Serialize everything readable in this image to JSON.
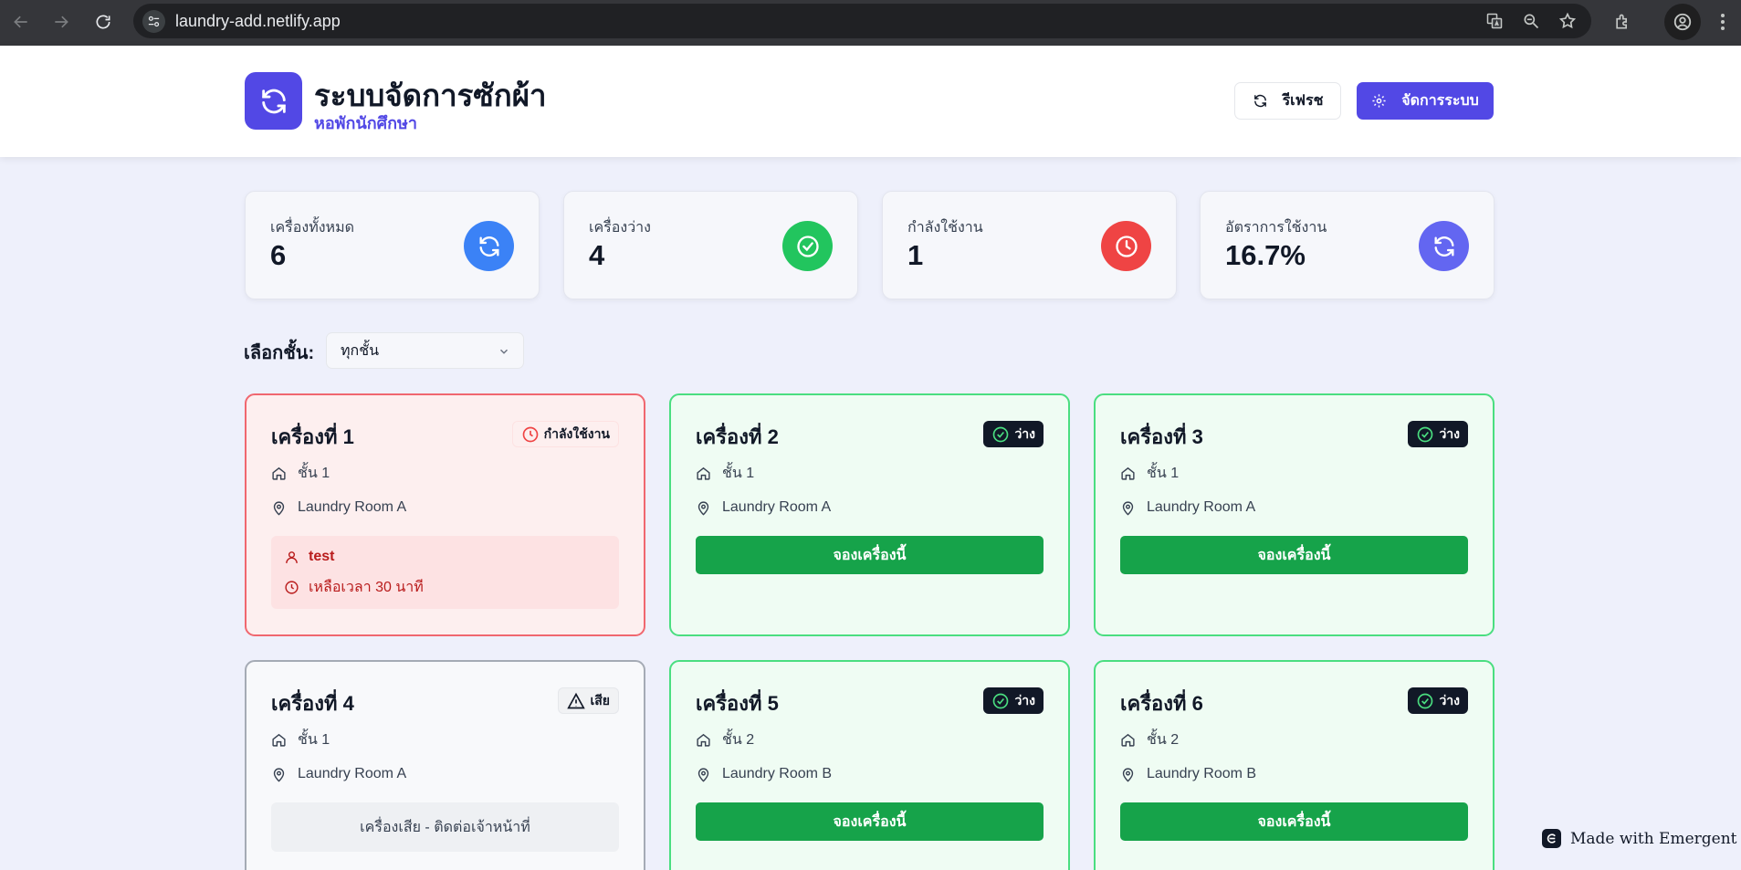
{
  "browser": {
    "url": "laundry-add.netlify.app"
  },
  "header": {
    "title": "ระบบจัดการซักผ้า",
    "subtitle": "หอพักนักศึกษา",
    "refresh_label": "รีเฟรช",
    "manage_label": "จัดการระบบ"
  },
  "stats": [
    {
      "label": "เครื่องทั้งหมด",
      "value": "6",
      "icon": "refresh-icon",
      "color": "#3b82f6"
    },
    {
      "label": "เครื่องว่าง",
      "value": "4",
      "icon": "check-circle-icon",
      "color": "#22c55e"
    },
    {
      "label": "กำลังใช้งาน",
      "value": "1",
      "icon": "clock-icon",
      "color": "#ef4444"
    },
    {
      "label": "อัตราการใช้งาน",
      "value": "16.7%",
      "icon": "refresh-icon",
      "color": "#6366f1"
    }
  ],
  "filter": {
    "label": "เลือกชั้น:",
    "selected": "ทุกชั้น"
  },
  "machines": [
    {
      "name": "เครื่องที่ 1",
      "status": "กำลังใช้งาน",
      "floor": "ชั้น 1",
      "room": "Laundry Room A",
      "user": "test",
      "remaining": "เหลือเวลา 30 นาที"
    },
    {
      "name": "เครื่องที่ 2",
      "status": "ว่าง",
      "floor": "ชั้น 1",
      "room": "Laundry Room A",
      "action": "จองเครื่องนี้"
    },
    {
      "name": "เครื่องที่ 3",
      "status": "ว่าง",
      "floor": "ชั้น 1",
      "room": "Laundry Room A",
      "action": "จองเครื่องนี้"
    },
    {
      "name": "เครื่องที่ 4",
      "status": "เสีย",
      "floor": "ชั้น 1",
      "room": "Laundry Room A",
      "note": "เครื่องเสีย - ติดต่อเจ้าหน้าที่"
    },
    {
      "name": "เครื่องที่ 5",
      "status": "ว่าง",
      "floor": "ชั้น 2",
      "room": "Laundry Room B",
      "action": "จองเครื่องนี้"
    },
    {
      "name": "เครื่องที่ 6",
      "status": "ว่าง",
      "floor": "ชั้น 2",
      "room": "Laundry Room B",
      "action": "จองเครื่องนี้"
    }
  ],
  "footer": {
    "badge": "Made with Emergent"
  },
  "colors": {
    "brand": "#5248e5",
    "free": "#16a34a",
    "busy": "#ef4444"
  }
}
